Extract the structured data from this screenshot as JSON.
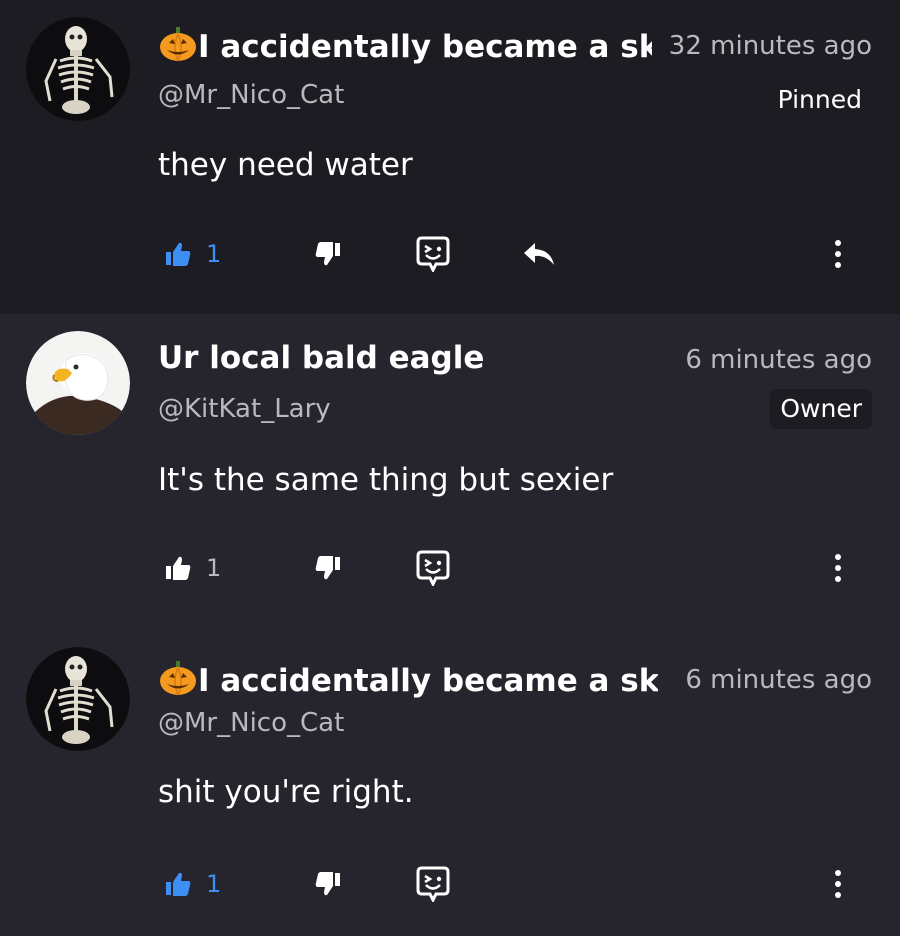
{
  "colors": {
    "page_bg": "#26252e",
    "pinned_bg": "#1d1c22",
    "accent": "#3d8ff3",
    "muted": "#b9b8bf"
  },
  "comments": [
    {
      "avatar": "skeleton-avatar",
      "name": "I accidentally became a sk",
      "name_icon": "pumpkin-icon",
      "handle": "@Mr_Nico_Cat",
      "time": "32 minutes ago",
      "badge": "Pinned",
      "text": "they need water",
      "likes": "1",
      "liked": true,
      "has_reply": true
    },
    {
      "avatar": "bald-eagle-avatar",
      "name": "Ur local bald eagle",
      "handle": "@KitKat_Lary",
      "time": "6 minutes ago",
      "badge": "Owner",
      "text": "It's the same thing but sexier",
      "likes": "1",
      "liked": false,
      "has_reply": false
    },
    {
      "avatar": "skeleton-avatar",
      "name": "I accidentally became a ske",
      "name_icon": "pumpkin-icon",
      "handle": "@Mr_Nico_Cat",
      "time": "6 minutes ago",
      "text": "shit you're right.",
      "likes": "1",
      "liked": true,
      "has_reply": false
    }
  ]
}
